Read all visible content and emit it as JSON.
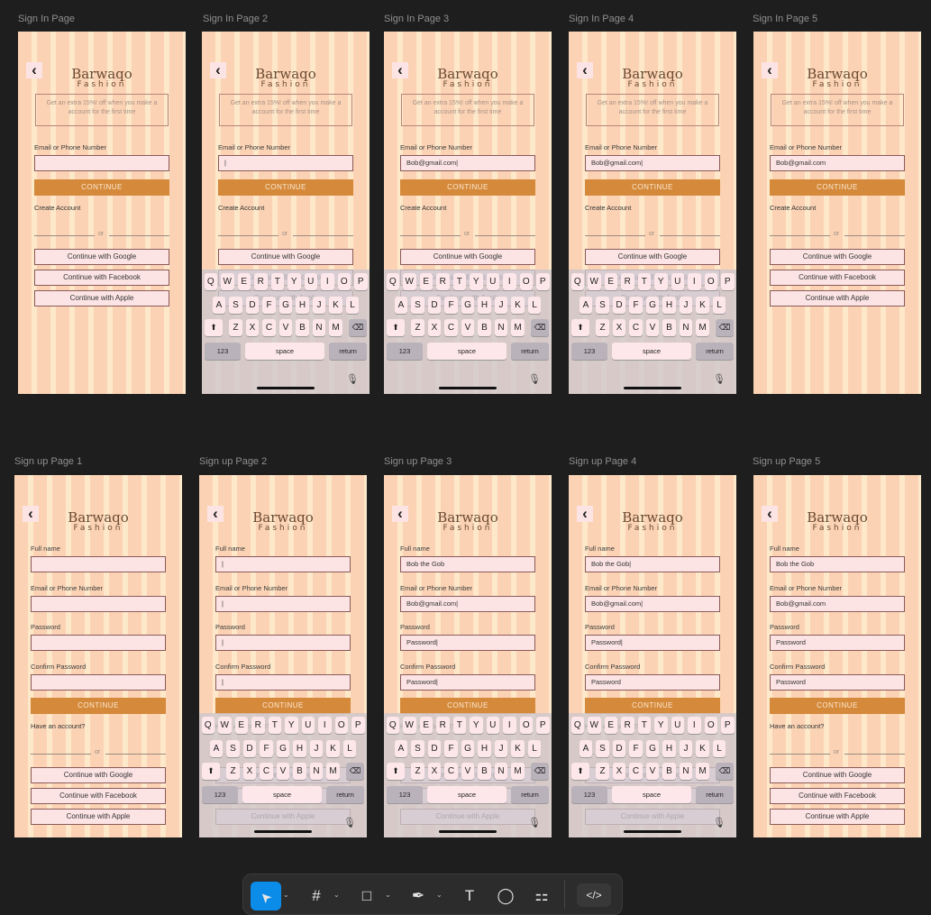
{
  "brand": {
    "name": "Barwaqo",
    "sub": "Fashion"
  },
  "icons": {
    "back": "chevron-left-icon",
    "backspace": "backspace-icon",
    "mic": "microphone-icon",
    "shift": "shift-arrow-icon"
  },
  "signin": {
    "promo": "Get an extra 15%! off when you make a account for the first time",
    "email_label": "Email or Phone Number",
    "continue": "CONTINUE",
    "create_account": "Create Account",
    "or": "or",
    "google": "Continue with Google",
    "facebook": "Continue with Facebook",
    "apple": "Continue with Apple"
  },
  "signup": {
    "fullname_label": "Full name",
    "email_label": "Email or Phone Number",
    "password_label": "Password",
    "confirm_label": "Confirm Password",
    "continue": "CONTINUE",
    "have_account": "Have an account?",
    "or": "or",
    "google": "Continue with Google",
    "facebook": "Continue with Facebook",
    "apple": "Continue with Apple"
  },
  "keyboard": {
    "row1": [
      "Q",
      "W",
      "E",
      "R",
      "T",
      "Y",
      "U",
      "I",
      "O",
      "P"
    ],
    "row2": [
      "A",
      "S",
      "D",
      "F",
      "G",
      "H",
      "J",
      "K",
      "L"
    ],
    "row3": [
      "Z",
      "X",
      "C",
      "V",
      "B",
      "N",
      "M"
    ],
    "num": "123",
    "space": "space",
    "return": "return"
  },
  "frames": {
    "signin": [
      {
        "label": "Sign In Page",
        "email": "",
        "keyboard": false
      },
      {
        "label": "Sign In Page 2",
        "email": "|",
        "keyboard": true
      },
      {
        "label": "Sign In Page 3",
        "email": "Bob@gmail.com|",
        "keyboard": true
      },
      {
        "label": "Sign In Page 4",
        "email": "Bob@gmail.com|",
        "keyboard": true
      },
      {
        "label": "Sign In Page 5",
        "email": "Bob@gmail.com",
        "keyboard": false
      }
    ],
    "signup": [
      {
        "label": "Sign up Page 1",
        "fullname": "",
        "email": "",
        "password": "",
        "confirm": "",
        "keyboard": false
      },
      {
        "label": "Sign up Page 2",
        "fullname": "|",
        "email": "|",
        "password": "|",
        "confirm": "|",
        "keyboard": true
      },
      {
        "label": "Sign up Page 3",
        "fullname": "Bob the Gob",
        "email": "Bob@gmail.com|",
        "password": "Password|",
        "confirm": "Password|",
        "keyboard": true
      },
      {
        "label": "Sign up Page 4",
        "fullname": "Bob the Gob|",
        "email": "Bob@gmail.com|",
        "password": "Password|",
        "confirm": "Password",
        "keyboard": true
      },
      {
        "label": "Sign up Page 5",
        "fullname": "Bob the Gob",
        "email": "Bob@gmail.com",
        "password": "Password",
        "confirm": "Password",
        "keyboard": false
      }
    ]
  },
  "toolbar": {
    "move": "move-tool-icon",
    "frame": "frame-tool-icon",
    "rectangle": "rectangle-tool-icon",
    "pen": "pen-tool-icon",
    "text": "text-tool-icon",
    "comment": "comment-tool-icon",
    "actions": "actions-icon",
    "dev_mode": "dev-mode-icon"
  }
}
